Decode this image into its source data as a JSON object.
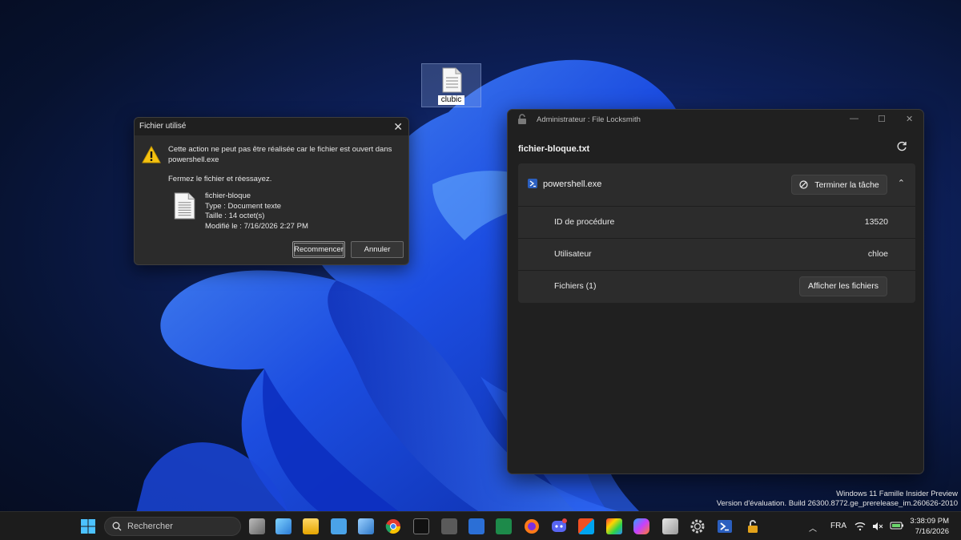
{
  "desktop": {
    "icon_label": "clubic"
  },
  "dialog": {
    "title": "Fichier utilisé",
    "message": "Cette action ne peut pas être réalisée car le fichier est ouvert dans powershell.exe",
    "instruction": "Fermez le fichier et réessayez.",
    "file_name": "fichier-bloque",
    "file_type": "Type : Document texte",
    "file_size": "Taille : 14 octet(s)",
    "file_modified": "Modifié le : 7/16/2026 2:27 PM",
    "retry_label": "Recommencer",
    "cancel_label": "Annuler"
  },
  "locksmith": {
    "window_title": "Administrateur : File Locksmith",
    "file": "fichier-bloque.txt",
    "process_name": "powershell.exe",
    "end_task_label": "Terminer la tâche",
    "rows": [
      {
        "label": "ID de procédure",
        "value": "13520"
      },
      {
        "label": "Utilisateur",
        "value": "chloe"
      },
      {
        "label": "Fichiers (1)",
        "button": "Afficher les fichiers"
      }
    ]
  },
  "watermark": {
    "line1": "Windows 11 Famille Insider Preview",
    "line2": "Version d'évaluation. Build 26300.8772.ge_prerelease_im.260626-2010"
  },
  "taskbar": {
    "search_placeholder": "Recherche r",
    "search_text": "Rechercher",
    "language": "FRA",
    "time": "3:38:09 PM",
    "date": "7/16/2026"
  }
}
